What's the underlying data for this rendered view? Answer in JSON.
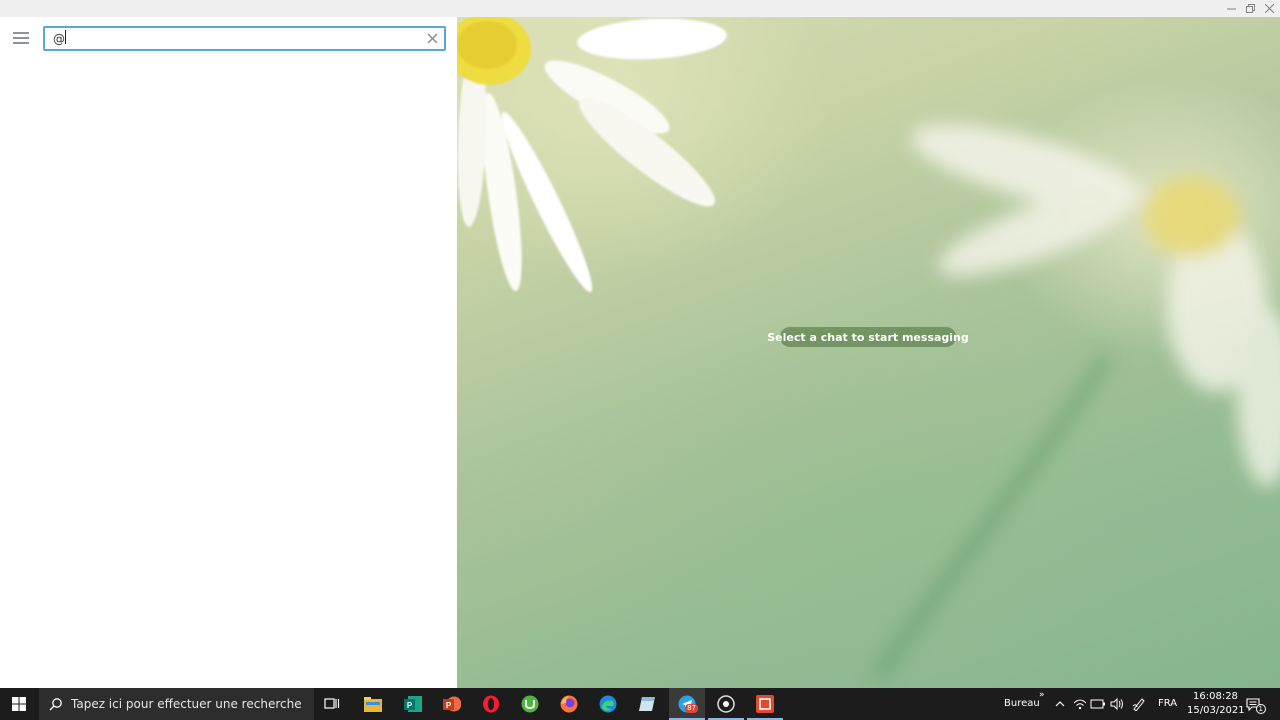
{
  "left_panel": {
    "search": {
      "value": "@",
      "placeholder": ""
    }
  },
  "chat": {
    "empty_label": "Select a chat to start messaging"
  },
  "taskbar": {
    "search_placeholder": "Tapez ici pour effectuer une recherche",
    "apps": [
      "start-icon",
      "task-view-icon",
      "file-explorer-icon",
      "publisher-icon",
      "powerpoint-icon",
      "opera-icon",
      "utorrent-icon",
      "firefox-icon",
      "edge-icon",
      "notes-icon",
      "telegram-icon",
      "media-player-icon",
      "screen-recorder-icon"
    ],
    "telegram_badge": "87",
    "desktop_label": "Bureau",
    "language": "FRA",
    "time": "16:08:28",
    "date": "15/03/2021",
    "notification_count": "1"
  },
  "colors": {
    "search_focus": "#58a7e0",
    "taskbar": "#1c1c1c",
    "pill": "#648755"
  }
}
